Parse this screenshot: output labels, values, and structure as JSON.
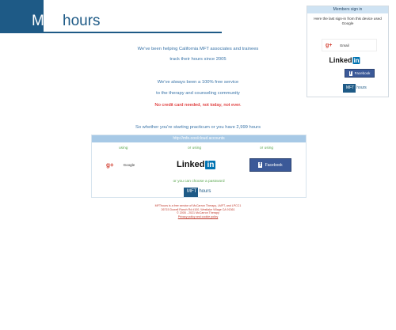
{
  "logo": {
    "part1": "MFT",
    "part2": "hours"
  },
  "members": {
    "header": "Members sign in",
    "note": "Here the last sign-in from this device used Google",
    "google_label": "Email",
    "linkedin_text": "Linked",
    "linkedin_in": "in",
    "facebook_label": "Facebook",
    "mft_a": "MFT",
    "mft_b": "hours"
  },
  "hero": {
    "line1": "We've been helping California MFT associates and trainees",
    "line2": "track their hours since 2005",
    "line3": "We've always been a 100% free service",
    "line4": "to the therapy and counseling community",
    "line5_red": "No credit card needed, not today,",
    "line5_red2": "not ever.",
    "line6": "So whether you're starting practicum or you have 2,999 hours"
  },
  "login": {
    "header": "http://mfe.ooo/cloud accounts",
    "using_label": "using",
    "or_using_label": "or using",
    "google_label": "Google",
    "linkedin_text": "Linked",
    "linkedin_in": "in",
    "facebook_label": "Facebook",
    "choose_text": "or you can choose a password",
    "mft_a": "MFT",
    "mft_b": "hours"
  },
  "footer": {
    "line1": "MFThours is a free service of McCarron Therapy, LMFT, and LPCC1",
    "line2": "26715 Dowell Ranch Rd #100, Westlake Village CA 91361",
    "line3": "© 2005 - 2021 McCarron Therapy",
    "line4": "Privacy policy and cookie policy"
  },
  "colors": {
    "brand": "#1e5a86",
    "accent_green": "#5aa64f",
    "alert_red": "#d60000",
    "facebook": "#3b5998",
    "linkedin": "#0073b1",
    "google": "#d23f31"
  }
}
